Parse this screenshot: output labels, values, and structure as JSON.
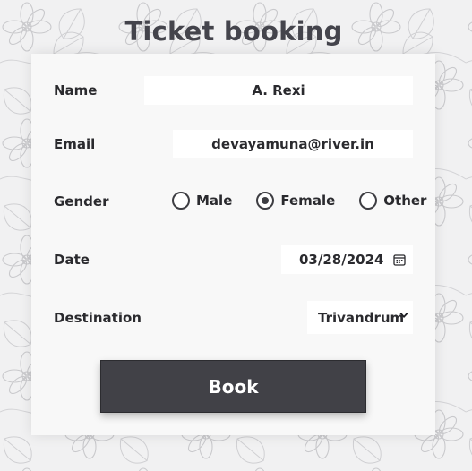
{
  "title": "Ticket booking",
  "form": {
    "name": {
      "label": "Name",
      "value": "A. Rexi"
    },
    "email": {
      "label": "Email",
      "value": "devayamuna@river.in"
    },
    "gender": {
      "label": "Gender",
      "options": [
        {
          "label": "Male",
          "selected": false
        },
        {
          "label": "Female",
          "selected": true
        },
        {
          "label": "Other",
          "selected": false
        }
      ]
    },
    "date": {
      "label": "Date",
      "value": "03/28/2024",
      "icon": "calendar-icon"
    },
    "destination": {
      "label": "Destination",
      "value": "Trivandrum",
      "icon": "chevron-down-icon"
    },
    "book_label": "Book"
  },
  "colors": {
    "page_background": "#f1f1f2",
    "card_background": "#f8f8f8",
    "button_background": "#414147",
    "title_color": "#44444c"
  }
}
